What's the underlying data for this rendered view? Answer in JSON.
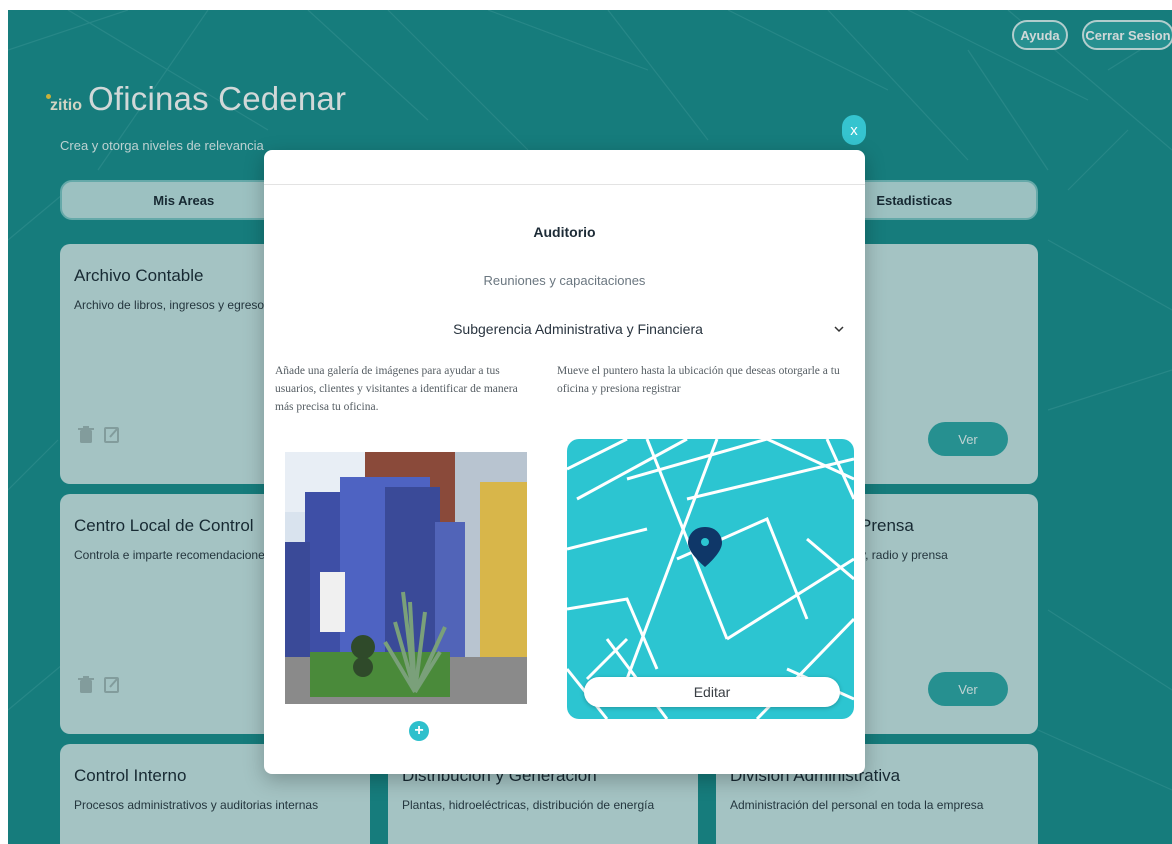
{
  "header": {
    "help_label": "Ayuda",
    "logout_label": "Cerrar Sesion"
  },
  "brand": {
    "logo_text": "zitio",
    "title": "Oficinas Cedenar",
    "subtitle": "Crea y otorga niveles de relevancia"
  },
  "tabs": [
    {
      "label": "Mis Areas"
    },
    {
      "label": "Estadisticas"
    }
  ],
  "cards": {
    "archivo": {
      "title": "Archivo Contable",
      "desc": "Archivo de libros, ingresos y egresos",
      "view_label": "Ver"
    },
    "centro": {
      "title": "Centro Local de Control",
      "desc": "Controla e imparte recomendaciones",
      "view_label": "Ver"
    },
    "right1": {
      "view_label": "Ver"
    },
    "prensa": {
      "title": "Prensa",
      "desc": "v, radio y prensa",
      "view_label": "Ver"
    },
    "control": {
      "title": "Control Interno",
      "desc": "Procesos administrativos y auditorias internas"
    },
    "distribucion": {
      "title": "Distribución y Generación",
      "desc": "Plantas, hidroeléctricas, distribución de energía"
    },
    "division": {
      "title": "División Administrativa",
      "desc": "Administración del personal en toda la empresa"
    }
  },
  "modal": {
    "close_label": "x",
    "name": "Auditorio",
    "type": "Reuniones y capacitaciones",
    "department": "Subgerencia Administrativa y Financiera",
    "gallery_note": "Añade una galería de imágenes para ayudar a tus usuarios, clientes y visitantes a identificar de manera más precisa tu oficina.",
    "map_note": "Mueve el puntero hasta la ubicación que deseas otorgarle a tu oficina y presiona registrar",
    "add_label": "+",
    "edit_label": "Editar"
  },
  "colors": {
    "background": "#1b8f8f",
    "accent": "#2ec0cc",
    "map": "#2cc5d1",
    "card": "#c9e6e6"
  },
  "icons": [
    "trash-icon",
    "edit-icon",
    "close-icon",
    "chevron-down-icon",
    "map-pin-icon",
    "plus-icon"
  ]
}
